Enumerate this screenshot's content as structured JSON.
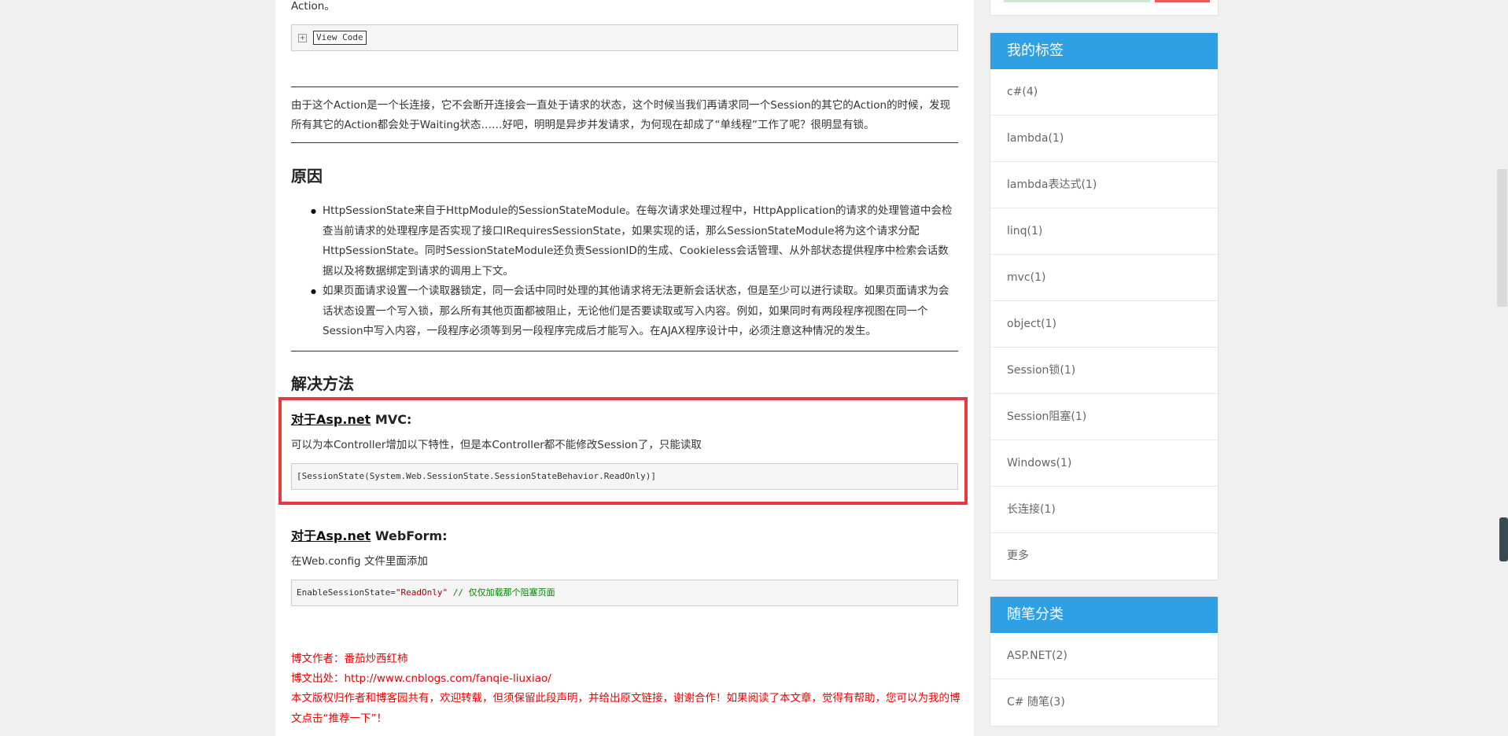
{
  "article": {
    "intro_fragment": "Action。",
    "view_code_label": "View Code",
    "expand_symbol": "+",
    "para1": "由于这个Action是一个长连接，它不会断开连接会一直处于请求的状态，这个时候当我们再请求同一个Session的其它的Action的时候，发现所有其它的Action都会处于Waiting状态……好吧，明明是异步并发请求，为何现在却成了“单线程”工作了呢？很明显有锁。",
    "h_reason": "原因",
    "bullets": [
      "HttpSessionState来自于HttpModule的SessionStateModule。在每次请求处理过程中，HttpApplication的请求的处理管道中会检查当前请求的处理程序是否实现了接口IRequiresSessionState，如果实现的话，那么SessionStateModule将为这个请求分配HttpSessionState。同时SessionStateModule还负责SessionID的生成、Cookieless会话管理、从外部状态提供程序中检索会话数据以及将数据绑定到请求的调用上下文。",
      "如果页面请求设置一个读取器锁定，同一会话中同时处理的其他请求将无法更新会话状态，但是至少可以进行读取。如果页面请求为会话状态设置一个写入锁，那么所有其他页面都被阻止，无论他们是否要读取或写入内容。例如，如果同时有两段程序视图在同一个Session中写入内容，一段程序必须等到另一段程序完成后才能写入。在AJAX程序设计中，必须注意这种情况的发生。"
    ],
    "h_solution": "解决方法",
    "mvc": {
      "heading_link": "对于Asp.net",
      "heading_rest": " MVC:",
      "desc": "可以为本Controller增加以下特性，但是本Controller都不能修改Session了，只能读取",
      "code": "[SessionState(System.Web.SessionState.SessionStateBehavior.ReadOnly)]"
    },
    "webform": {
      "heading_link": "对于Asp.net",
      "heading_rest": " WebForm:",
      "desc": "在Web.config 文件里面添加",
      "code_key": "EnableSessionState=",
      "code_val": "\"ReadOnly\"",
      "code_comment": " // 仅仅加载那个阻塞页面"
    },
    "footer": {
      "author": "博文作者：番茄炒西红柿",
      "source": "博文出处：http://www.cnblogs.com/fanqie-liuxiao/",
      "copyright": "本文版权归作者和博客园共有，欢迎转载，但须保留此段声明，并给出原文链接，谢谢合作！如果阅读了本文章，觉得有帮助，您可以为我的博文点击“推荐一下”！"
    }
  },
  "sidebar": {
    "tags": {
      "title": "我的标签",
      "items": [
        "c#(4)",
        "lambda(1)",
        "lambda表达式(1)",
        "linq(1)",
        "mvc(1)",
        "object(1)",
        "Session锁(1)",
        "Session阻塞(1)",
        "Windows(1)",
        "长连接(1)",
        "更多"
      ]
    },
    "categories": {
      "title": "随笔分类",
      "items": [
        "ASP.NET(2)",
        "C# 随笔(3)"
      ]
    }
  },
  "colors": {
    "accent": "#2fa0e4",
    "highlight": "#e8393f",
    "footer_text": "#ee0000"
  }
}
